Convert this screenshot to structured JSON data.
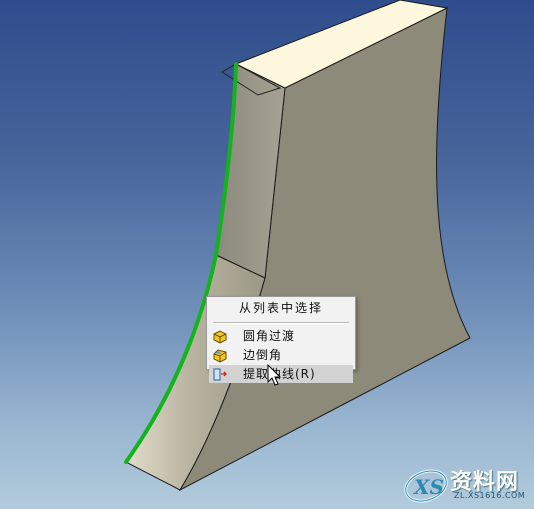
{
  "context_menu": {
    "title": "从列表中选择",
    "items": [
      {
        "label": "圆角过渡",
        "icon": "fillet-icon"
      },
      {
        "label": "边倒角",
        "icon": "chamfer-icon"
      },
      {
        "label": "提取曲线(R)",
        "icon": "extract-curve-icon",
        "highlighted": true
      }
    ]
  },
  "watermark": {
    "text": "资料网",
    "url": "ZL.XS1616.COM",
    "logo": "XS"
  },
  "colors": {
    "selected_edge": "#12b31c",
    "top_face": "#fff7de",
    "side_face": "#8e8a7a",
    "menu_highlight": "#d3d3d3"
  }
}
